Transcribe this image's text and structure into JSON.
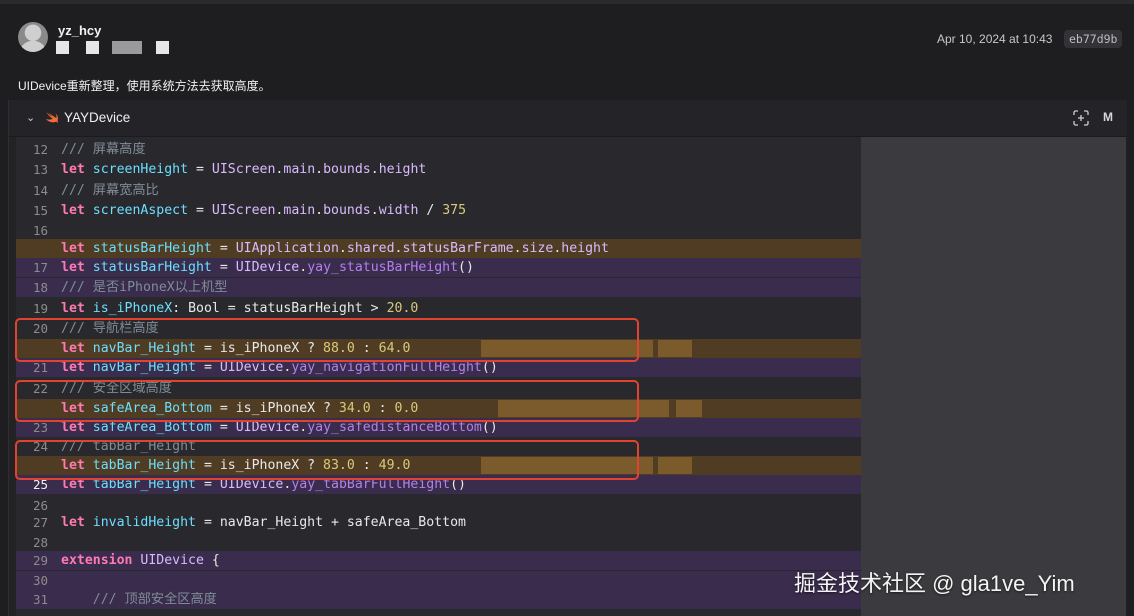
{
  "commit": {
    "author": "yz_hcy",
    "date": "Apr 10, 2024 at 10:43",
    "hash": "eb77d9b",
    "message": "UIDevice重新整理，使用系统方法去获取高度。"
  },
  "file": {
    "name": "YAYDevice",
    "status": "M",
    "icon": "swift-icon"
  },
  "code_lines": [
    {
      "ln": "12",
      "type": "ctx",
      "tokens": [
        {
          "c": "cm",
          "t": "/// 屏幕高度"
        }
      ]
    },
    {
      "ln": "13",
      "type": "ctx",
      "tokens": [
        {
          "c": "kw",
          "t": "let"
        },
        {
          "c": "tx",
          "t": " "
        },
        {
          "c": "id",
          "t": "screenHeight"
        },
        {
          "c": "tx",
          "t": " = "
        },
        {
          "c": "ty",
          "t": "UIScreen"
        },
        {
          "c": "tx",
          "t": "."
        },
        {
          "c": "ty",
          "t": "main"
        },
        {
          "c": "tx",
          "t": "."
        },
        {
          "c": "ty",
          "t": "bounds"
        },
        {
          "c": "tx",
          "t": "."
        },
        {
          "c": "ty",
          "t": "height"
        }
      ]
    },
    {
      "ln": "14",
      "type": "ctx",
      "tokens": [
        {
          "c": "cm",
          "t": "/// 屏幕宽高比"
        }
      ]
    },
    {
      "ln": "15",
      "type": "ctx",
      "tokens": [
        {
          "c": "kw",
          "t": "let"
        },
        {
          "c": "tx",
          "t": " "
        },
        {
          "c": "id",
          "t": "screenAspect"
        },
        {
          "c": "tx",
          "t": " = "
        },
        {
          "c": "ty",
          "t": "UIScreen"
        },
        {
          "c": "tx",
          "t": "."
        },
        {
          "c": "ty",
          "t": "main"
        },
        {
          "c": "tx",
          "t": "."
        },
        {
          "c": "ty",
          "t": "bounds"
        },
        {
          "c": "tx",
          "t": "."
        },
        {
          "c": "ty",
          "t": "width"
        },
        {
          "c": "tx",
          "t": " / "
        },
        {
          "c": "num",
          "t": "375"
        }
      ]
    },
    {
      "ln": "16",
      "type": "ctx",
      "tokens": []
    },
    {
      "ln": "",
      "type": "del",
      "tokens": [
        {
          "c": "kw",
          "t": "let"
        },
        {
          "c": "tx",
          "t": " "
        },
        {
          "c": "id",
          "t": "statusBarHeight"
        },
        {
          "c": "tx",
          "t": " = "
        },
        {
          "c": "ty",
          "t": "UIApplication"
        },
        {
          "c": "tx",
          "t": "."
        },
        {
          "c": "ty",
          "t": "shared"
        },
        {
          "c": "tx",
          "t": "."
        },
        {
          "c": "ty",
          "t": "statusBarFrame"
        },
        {
          "c": "tx",
          "t": "."
        },
        {
          "c": "ty",
          "t": "size"
        },
        {
          "c": "tx",
          "t": "."
        },
        {
          "c": "ty",
          "t": "height"
        }
      ]
    },
    {
      "ln": "17",
      "type": "add",
      "tokens": [
        {
          "c": "kw",
          "t": "let"
        },
        {
          "c": "tx",
          "t": " "
        },
        {
          "c": "id",
          "t": "statusBarHeight"
        },
        {
          "c": "tx",
          "t": " = "
        },
        {
          "c": "ty",
          "t": "UIDevice"
        },
        {
          "c": "tx",
          "t": "."
        },
        {
          "c": "fn",
          "t": "yay_statusBarHeight"
        },
        {
          "c": "tx",
          "t": "()"
        }
      ]
    },
    {
      "ln": "18",
      "type": "add",
      "tokens": [
        {
          "c": "cm",
          "t": "/// 是否iPhoneX以上机型"
        }
      ]
    },
    {
      "ln": "19",
      "type": "ctx",
      "tokens": [
        {
          "c": "kw",
          "t": "let"
        },
        {
          "c": "tx",
          "t": " "
        },
        {
          "c": "id",
          "t": "is_iPhoneX"
        },
        {
          "c": "tx",
          "t": ": Bool = statusBarHeight > "
        },
        {
          "c": "num",
          "t": "20.0"
        }
      ]
    },
    {
      "ln": "20",
      "type": "ctx",
      "tokens": [
        {
          "c": "cm",
          "t": "/// 导航栏高度"
        }
      ]
    },
    {
      "ln": "",
      "type": "del",
      "tokens": [
        {
          "c": "kw",
          "t": "let"
        },
        {
          "c": "tx",
          "t": " "
        },
        {
          "c": "id",
          "t": "navBar_Height"
        },
        {
          "c": "tx",
          "t": " = is_iPhoneX ? "
        },
        {
          "c": "num",
          "t": "88.0"
        },
        {
          "c": "tx",
          "t": " : "
        },
        {
          "c": "num",
          "t": "64.0"
        }
      ]
    },
    {
      "ln": "21",
      "type": "add",
      "tokens": [
        {
          "c": "kw",
          "t": "let"
        },
        {
          "c": "tx",
          "t": " "
        },
        {
          "c": "id",
          "t": "navBar_Height"
        },
        {
          "c": "tx",
          "t": " = "
        },
        {
          "c": "ty",
          "t": "UIDevice"
        },
        {
          "c": "tx",
          "t": "."
        },
        {
          "c": "fn",
          "t": "yay_navigationFullHeight"
        },
        {
          "c": "tx",
          "t": "()"
        }
      ]
    },
    {
      "ln": "22",
      "type": "ctx",
      "tokens": [
        {
          "c": "cm",
          "t": "/// 安全区域高度"
        }
      ]
    },
    {
      "ln": "",
      "type": "del",
      "tokens": [
        {
          "c": "kw",
          "t": "let"
        },
        {
          "c": "tx",
          "t": " "
        },
        {
          "c": "id",
          "t": "safeArea_Bottom"
        },
        {
          "c": "tx",
          "t": " = is_iPhoneX ? "
        },
        {
          "c": "num",
          "t": "34.0"
        },
        {
          "c": "tx",
          "t": " : "
        },
        {
          "c": "num",
          "t": "0.0"
        }
      ]
    },
    {
      "ln": "23",
      "type": "add",
      "tokens": [
        {
          "c": "kw",
          "t": "let"
        },
        {
          "c": "tx",
          "t": " "
        },
        {
          "c": "id",
          "t": "safeArea_Bottom"
        },
        {
          "c": "tx",
          "t": " = "
        },
        {
          "c": "ty",
          "t": "UIDevice"
        },
        {
          "c": "tx",
          "t": "."
        },
        {
          "c": "fn",
          "t": "yay_safedistanceBottom"
        },
        {
          "c": "tx",
          "t": "()"
        }
      ]
    },
    {
      "ln": "24",
      "type": "ctx",
      "tokens": [
        {
          "c": "cm",
          "t": "/// tabBar_Height"
        }
      ]
    },
    {
      "ln": "",
      "type": "del",
      "tokens": [
        {
          "c": "kw",
          "t": "let"
        },
        {
          "c": "tx",
          "t": " "
        },
        {
          "c": "id",
          "t": "tabBar_Height"
        },
        {
          "c": "tx",
          "t": " = is_iPhoneX ? "
        },
        {
          "c": "num",
          "t": "83.0"
        },
        {
          "c": "tx",
          "t": " : "
        },
        {
          "c": "num",
          "t": "49.0"
        }
      ]
    },
    {
      "ln": "25",
      "type": "add",
      "current": true,
      "tokens": [
        {
          "c": "kw",
          "t": "let"
        },
        {
          "c": "tx",
          "t": " "
        },
        {
          "c": "id",
          "t": "tabBar_Height"
        },
        {
          "c": "tx",
          "t": " = "
        },
        {
          "c": "ty",
          "t": "UIDevice"
        },
        {
          "c": "tx",
          "t": "."
        },
        {
          "c": "fn",
          "t": "yay_tabBarFullHeight"
        },
        {
          "c": "tx",
          "t": "()"
        }
      ]
    },
    {
      "ln": "26",
      "type": "ctx",
      "tokens": []
    },
    {
      "ln": "27",
      "type": "ctx",
      "tokens": [
        {
          "c": "kw",
          "t": "let"
        },
        {
          "c": "tx",
          "t": " "
        },
        {
          "c": "id",
          "t": "invalidHeight"
        },
        {
          "c": "tx",
          "t": " = navBar_Height + safeArea_Bottom"
        }
      ]
    },
    {
      "ln": "28",
      "type": "ctx",
      "tokens": []
    },
    {
      "ln": "29",
      "type": "add",
      "tokens": [
        {
          "c": "kw",
          "t": "extension"
        },
        {
          "c": "tx",
          "t": " "
        },
        {
          "c": "ty",
          "t": "UIDevice"
        },
        {
          "c": "tx",
          "t": " {"
        }
      ]
    },
    {
      "ln": "30",
      "type": "add",
      "tokens": []
    },
    {
      "ln": "31",
      "type": "add",
      "tokens": [
        {
          "c": "tx",
          "t": "    "
        },
        {
          "c": "cm",
          "t": "/// 顶部安全区高度"
        }
      ]
    }
  ],
  "watermark": "掘金技术社区 @ gla1ve_Yim",
  "colors": {
    "context_bg": "#29292d",
    "deleted_bg": "#4f3c22",
    "added_bg": "#3a2c4c",
    "annotation_border": "#e0432f"
  }
}
